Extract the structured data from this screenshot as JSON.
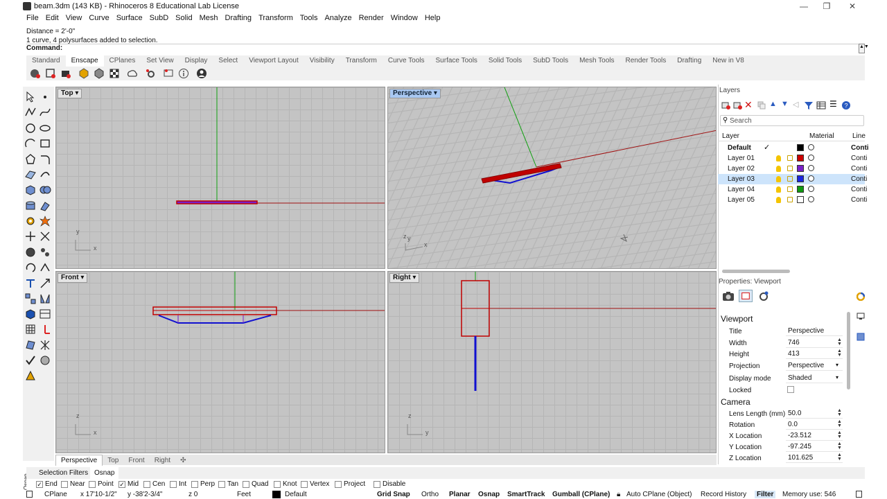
{
  "window": {
    "title": "beam.3dm (143 KB) - Rhinoceros 8 Educational Lab License",
    "controls": [
      "—",
      "❐",
      "✕"
    ]
  },
  "menu": [
    "File",
    "Edit",
    "View",
    "Curve",
    "Surface",
    "SubD",
    "Solid",
    "Mesh",
    "Drafting",
    "Transform",
    "Tools",
    "Analyze",
    "Render",
    "Window",
    "Help"
  ],
  "command_history": [
    "Distance = 2'-0\"",
    "1 curve, 4 polysurfaces added to selection."
  ],
  "command_prompt": "Command:",
  "toolbar_tabs": [
    "Standard",
    "Enscape",
    "CPlanes",
    "Set View",
    "Display",
    "Select",
    "Viewport Layout",
    "Visibility",
    "Transform",
    "Curve Tools",
    "Surface Tools",
    "Solid Tools",
    "SubD Tools",
    "Mesh Tools",
    "Render Tools",
    "Drafting",
    "New in V8"
  ],
  "active_toolbar_tab": "Enscape",
  "viewports": {
    "top": {
      "label": "Top",
      "axis1": "y",
      "axis2": "x"
    },
    "perspective": {
      "label": "Perspective",
      "axis1": "z",
      "axis2": "y",
      "axis3": "x"
    },
    "front": {
      "label": "Front",
      "axis1": "z",
      "axis2": "x"
    },
    "right": {
      "label": "Right",
      "axis1": "z",
      "axis2": "y"
    }
  },
  "viewport_tabs": [
    "Perspective",
    "Top",
    "Front",
    "Right"
  ],
  "add_viewport_tab": "✣",
  "layers_panel": {
    "title": "Layers",
    "search_placeholder": "Search",
    "columns": {
      "layer": "Layer",
      "material": "Material",
      "linetype": "Line"
    },
    "rows": [
      {
        "name": "Default",
        "current": true,
        "color": "#000000",
        "linetype": "Conti"
      },
      {
        "name": "Layer 01",
        "current": false,
        "color": "#cc0000",
        "linetype": "Conti"
      },
      {
        "name": "Layer 02",
        "current": false,
        "color": "#7a20c8",
        "linetype": "Conti"
      },
      {
        "name": "Layer 03",
        "current": false,
        "color": "#1a24e0",
        "linetype": "Conti",
        "selected": true
      },
      {
        "name": "Layer 04",
        "current": false,
        "color": "#109a10",
        "linetype": "Conti"
      },
      {
        "name": "Layer 05",
        "current": false,
        "color": "#ffffff",
        "linetype": "Conti"
      }
    ],
    "current_mark": "✓"
  },
  "properties": {
    "title": "Properties: Viewport",
    "viewport_section": "Viewport",
    "viewport_rows": [
      {
        "key": "Title",
        "value": "Perspective",
        "kind": "text"
      },
      {
        "key": "Width",
        "value": "746",
        "kind": "spin"
      },
      {
        "key": "Height",
        "value": "413",
        "kind": "spin"
      },
      {
        "key": "Projection",
        "value": "Perspective",
        "kind": "dropdown"
      },
      {
        "key": "Display mode",
        "value": "Shaded",
        "kind": "dropdown"
      },
      {
        "key": "Locked",
        "value": "",
        "kind": "checkbox"
      }
    ],
    "camera_section": "Camera",
    "camera_rows": [
      {
        "key": "Lens Length (mm)",
        "value": "50.0"
      },
      {
        "key": "Rotation",
        "value": "0.0"
      },
      {
        "key": "X Location",
        "value": "-23.512"
      },
      {
        "key": "Y Location",
        "value": "-97.245"
      },
      {
        "key": "Z Location",
        "value": "101.625"
      }
    ]
  },
  "bottom_tabs": {
    "selection_filters": "Selection Filters",
    "osnap": "Osnap",
    "side_label": "Osnap"
  },
  "osnaps": [
    {
      "label": "End",
      "checked": true
    },
    {
      "label": "Near",
      "checked": false
    },
    {
      "label": "Point",
      "checked": false
    },
    {
      "label": "Mid",
      "checked": true
    },
    {
      "label": "Cen",
      "checked": false
    },
    {
      "label": "Int",
      "checked": false
    },
    {
      "label": "Perp",
      "checked": false
    },
    {
      "label": "Tan",
      "checked": false
    },
    {
      "label": "Quad",
      "checked": false
    },
    {
      "label": "Knot",
      "checked": false
    },
    {
      "label": "Vertex",
      "checked": false
    },
    {
      "label": "Project",
      "checked": false
    },
    {
      "label": "Disable",
      "checked": false
    }
  ],
  "status": {
    "cplane": "CPlane",
    "x": "x 17'10-1/2\"",
    "y": "y -38'2-3/4\"",
    "z": "z 0",
    "units": "Feet",
    "layer": "Default",
    "toggles": [
      "Grid Snap",
      "Ortho",
      "Planar",
      "Osnap",
      "SmartTrack",
      "Gumball (CPlane)"
    ],
    "auto_cplane": "Auto CPlane (Object)",
    "record_history": "Record History",
    "filter": "Filter",
    "memory": "Memory use: 546"
  },
  "colors": {
    "x_axis": "#a01010",
    "y_axis": "#10a010",
    "beam_red": "#c00000",
    "beam_blue": "#1010d0",
    "selected_row": "#cde4fb",
    "active_viewport_label": "#a9c8f2"
  }
}
